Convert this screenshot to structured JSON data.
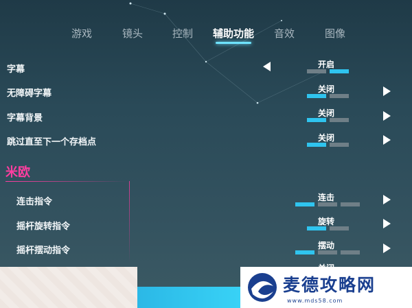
{
  "tabs": [
    {
      "label": "游戏"
    },
    {
      "label": "镜头"
    },
    {
      "label": "控制"
    },
    {
      "label": "辅助功能"
    },
    {
      "label": "音效"
    },
    {
      "label": "图像"
    }
  ],
  "active_tab": "辅助功能",
  "settings": [
    {
      "label": "字幕",
      "value": "开启",
      "segments_total": 2,
      "selected_index": 1
    },
    {
      "label": "无障碍字幕",
      "value": "关闭",
      "segments_total": 2,
      "selected_index": 0
    },
    {
      "label": "字幕背景",
      "value": "关闭",
      "segments_total": 2,
      "selected_index": 0
    },
    {
      "label": "跳过直至下一个存档点",
      "value": "关闭",
      "segments_total": 2,
      "selected_index": 0
    }
  ],
  "section": {
    "title": "米欧",
    "settings": [
      {
        "label": "连击指令",
        "value": "连击",
        "segments_total": 3,
        "selected_index": 0
      },
      {
        "label": "摇杆旋转指令",
        "value": "旋转",
        "segments_total": 2,
        "selected_index": 0
      },
      {
        "label": "摇杆摆动指令",
        "value": "摆动",
        "segments_total": 3,
        "selected_index": 0
      }
    ],
    "cutoff_value": "关闭"
  },
  "watermark": {
    "title": "麦德攻略网",
    "url": "www.mds58.com"
  },
  "colors": {
    "accent": "#2fc4ef",
    "section": "#ff3ea0",
    "inactive_segment": "#6f7f87"
  }
}
